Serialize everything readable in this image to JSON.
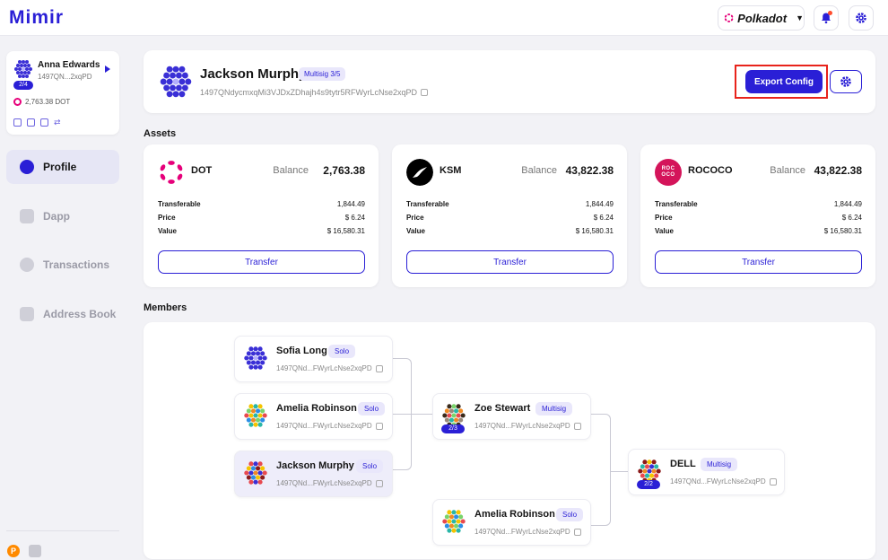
{
  "app": {
    "logo": "Mimir"
  },
  "topbar": {
    "network_label": "Polkadot"
  },
  "sidebar": {
    "account": {
      "name": "Anna Edwards",
      "address": "1497QN...2xqPD",
      "badge": "2/4",
      "balance": "2,763.38 DOT"
    },
    "nav": [
      {
        "label": "Profile",
        "active": true
      },
      {
        "label": "Dapp",
        "active": false
      },
      {
        "label": "Transactions",
        "active": false
      },
      {
        "label": "Address Book",
        "active": false
      }
    ],
    "footer_icon": "P"
  },
  "header": {
    "name": "Jackson Murphy",
    "tag": "Multisig 3/5",
    "address": "1497QNdycmxqMi3VJDxZDhajh4s9tytr5RFWyrLcNse2xqPD",
    "export_label": "Export Config"
  },
  "sections": {
    "assets": "Assets",
    "members": "Members"
  },
  "assets": [
    {
      "symbol": "DOT",
      "balance_label": "Balance",
      "balance": "2,763.38",
      "logo_text": "",
      "logo_color": "#e6007a",
      "rows": [
        {
          "k": "Transferable",
          "v": "1,844.49"
        },
        {
          "k": "Price",
          "v": "$ 6.24"
        },
        {
          "k": "Value",
          "v": "$ 16,580.31"
        }
      ],
      "button": "Transfer"
    },
    {
      "symbol": "KSM",
      "balance_label": "Balance",
      "balance": "43,822.38",
      "logo_text": "",
      "logo_color": "#000000",
      "rows": [
        {
          "k": "Transferable",
          "v": "1,844.49"
        },
        {
          "k": "Price",
          "v": "$ 6.24"
        },
        {
          "k": "Value",
          "v": "$ 16,580.31"
        }
      ],
      "button": "Transfer"
    },
    {
      "symbol": "ROCOCO",
      "balance_label": "Balance",
      "balance": "43,822.38",
      "logo_text": "ROC OCO",
      "logo_color": "#d4145a",
      "rows": [
        {
          "k": "Transferable",
          "v": "1,844.49"
        },
        {
          "k": "Price",
          "v": "$ 6.24"
        },
        {
          "k": "Value",
          "v": "$ 16,580.31"
        }
      ],
      "button": "Transfer"
    }
  ],
  "members": [
    {
      "name": "Sofia Long",
      "tag": "Solo",
      "address": "1497QNd...FWyrLcNse2xqPD",
      "badge": ""
    },
    {
      "name": "Amelia Robinson",
      "tag": "Solo",
      "address": "1497QNd...FWyrLcNse2xqPD",
      "badge": ""
    },
    {
      "name": "Jackson Murphy",
      "tag": "Solo",
      "address": "1497QNd...FWyrLcNse2xqPD",
      "badge": ""
    },
    {
      "name": "Zoe Stewart",
      "tag": "Multisig",
      "address": "1497QNd...FWyrLcNse2xqPD",
      "badge": "2/3"
    },
    {
      "name": "Amelia Robinson",
      "tag": "Solo",
      "address": "1497QNd...FWyrLcNse2xqPD",
      "badge": ""
    },
    {
      "name": "DELL",
      "tag": "Multisig",
      "address": "1497QNd...FWyrLcNse2xqPD",
      "badge": "2/2"
    }
  ],
  "colors": {
    "accent": "#2a1fd6",
    "highlight_outline": "#e8231b",
    "polkadot_pink": "#e6007a"
  }
}
